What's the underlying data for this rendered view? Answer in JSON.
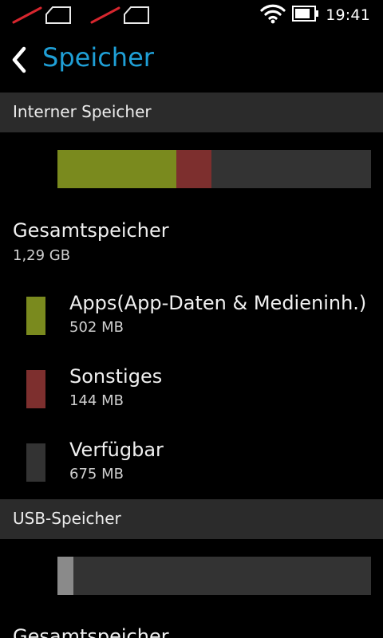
{
  "status_bar": {
    "time": "19:41",
    "icons": [
      "no-sim-icon",
      "no-sim-icon",
      "wifi-icon",
      "battery-icon"
    ]
  },
  "header": {
    "title": "Speicher",
    "back_icon": "chevron-left-icon"
  },
  "colors": {
    "accent": "#1f9fd6",
    "apps": "#7a8a1e",
    "other": "#7d2f2e",
    "free": "#333333",
    "usb_used": "#8a8a8a"
  },
  "internal": {
    "section_label": "Interner Speicher",
    "usage": {
      "apps_fraction": 0.38,
      "other_fraction": 0.11,
      "free_fraction": 0.51
    },
    "total_label": "Gesamtspeicher",
    "total_value": "1,29 GB",
    "items": [
      {
        "label": "Apps(App-Daten & Medieninh.)",
        "size": "502 MB"
      },
      {
        "label": "Sonstiges",
        "size": "144 MB"
      },
      {
        "label": "Verfügbar",
        "size": "675 MB"
      }
    ]
  },
  "usb": {
    "section_label": "USB-Speicher",
    "usage": {
      "used_fraction": 0.05,
      "free_fraction": 0.95
    },
    "total_label": "Gesamtspeicher"
  }
}
